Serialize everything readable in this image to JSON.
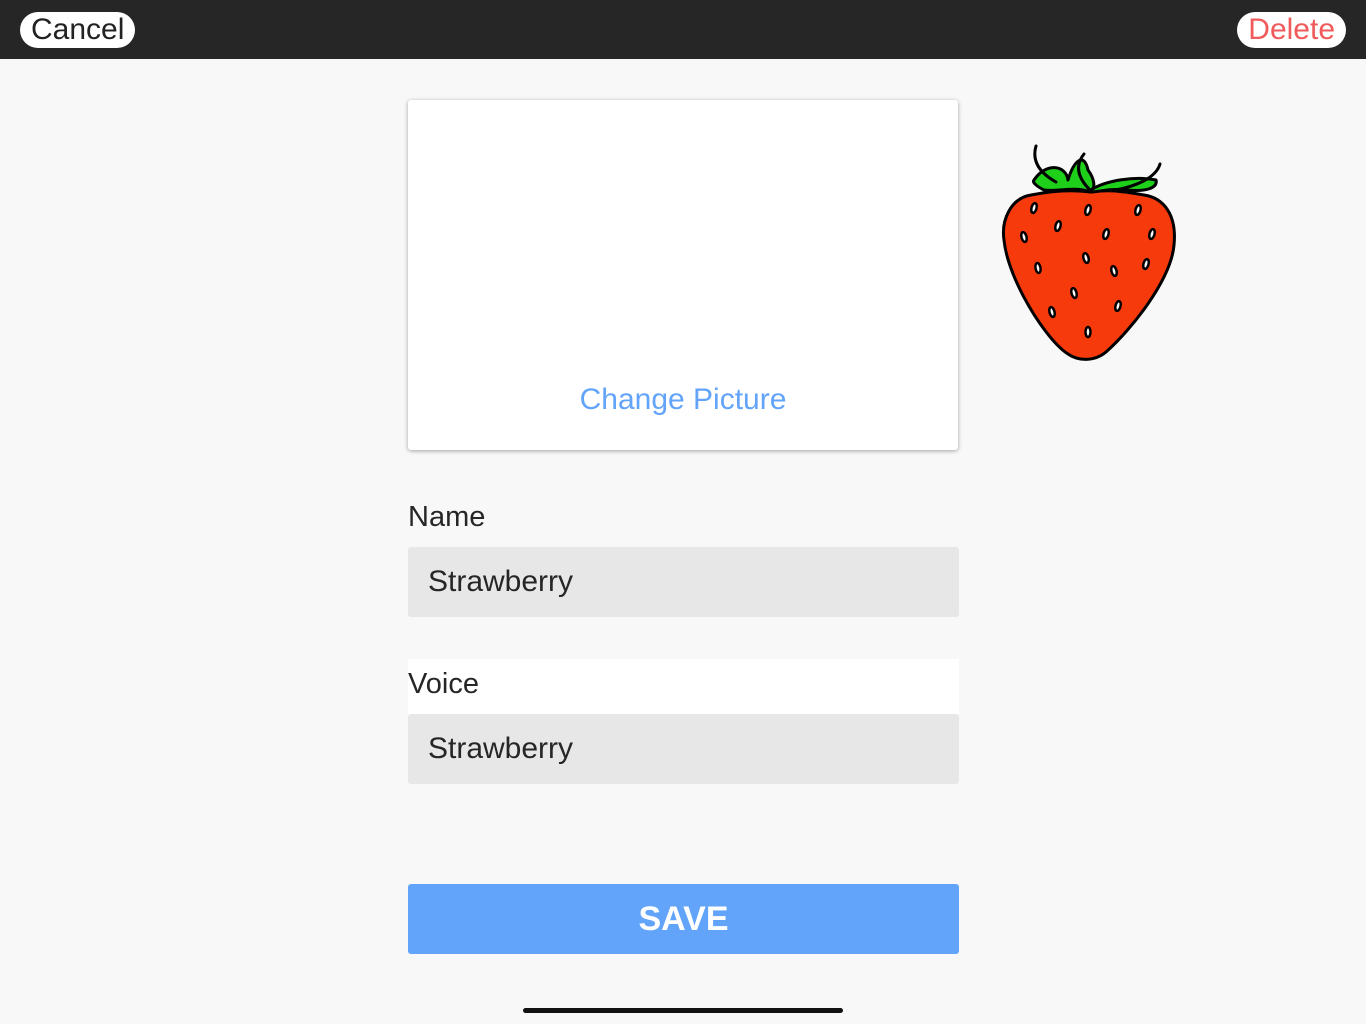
{
  "header": {
    "cancel_label": "Cancel",
    "delete_label": "Delete"
  },
  "picture": {
    "icon": "strawberry-image",
    "change_label": "Change Picture"
  },
  "form": {
    "name_label": "Name",
    "name_value": "Strawberry",
    "voice_label": "Voice",
    "voice_value": "Strawberry"
  },
  "actions": {
    "save_label": "SAVE"
  },
  "colors": {
    "accent": "#62a4fa",
    "danger": "#f05a5a",
    "topbar": "#262626"
  }
}
